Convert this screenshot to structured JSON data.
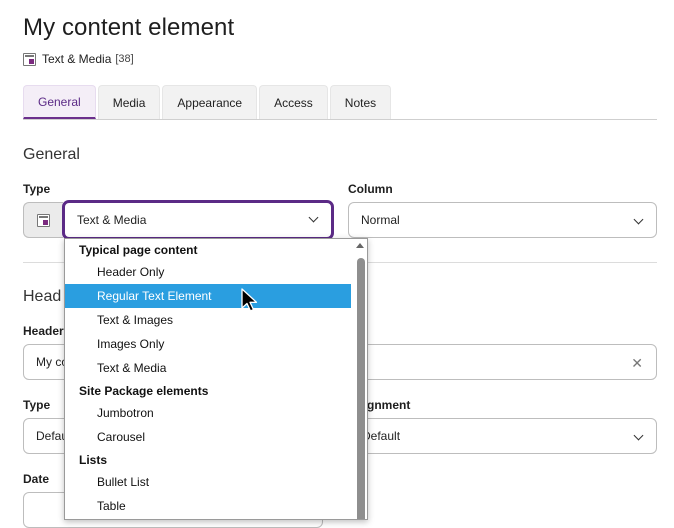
{
  "header": {
    "title": "My content element",
    "record_type": "Text & Media",
    "record_uid": "[38]"
  },
  "tabs": [
    {
      "label": "General",
      "active": true
    },
    {
      "label": "Media",
      "active": false
    },
    {
      "label": "Appearance",
      "active": false
    },
    {
      "label": "Access",
      "active": false
    },
    {
      "label": "Notes",
      "active": false
    }
  ],
  "general": {
    "section_title": "General",
    "type_label": "Type",
    "type_value": "Text & Media",
    "column_label": "Column",
    "column_value": "Normal"
  },
  "headlines": {
    "section_title_partial": "Head",
    "header_label_partial": "Header",
    "header_value_partial": "My co",
    "type_label": "Type",
    "type_value_partial": "Defau",
    "alignment_label_partial": "gnment",
    "alignment_value_partial": "Default",
    "date_label": "Date"
  },
  "dropdown": {
    "groups": [
      {
        "label": "Typical page content",
        "options": [
          {
            "label": "Header Only",
            "selected": false
          },
          {
            "label": "Regular Text Element",
            "selected": true
          },
          {
            "label": "Text & Images",
            "selected": false
          },
          {
            "label": "Images Only",
            "selected": false
          },
          {
            "label": "Text & Media",
            "selected": false
          }
        ]
      },
      {
        "label": "Site Package elements",
        "options": [
          {
            "label": "Jumbotron",
            "selected": false
          },
          {
            "label": "Carousel",
            "selected": false
          }
        ]
      },
      {
        "label": "Lists",
        "options": [
          {
            "label": "Bullet List",
            "selected": false
          },
          {
            "label": "Table",
            "selected": false
          }
        ]
      }
    ]
  },
  "colors": {
    "accent": "#5b2a86",
    "selected_option": "#2a9ee0"
  }
}
